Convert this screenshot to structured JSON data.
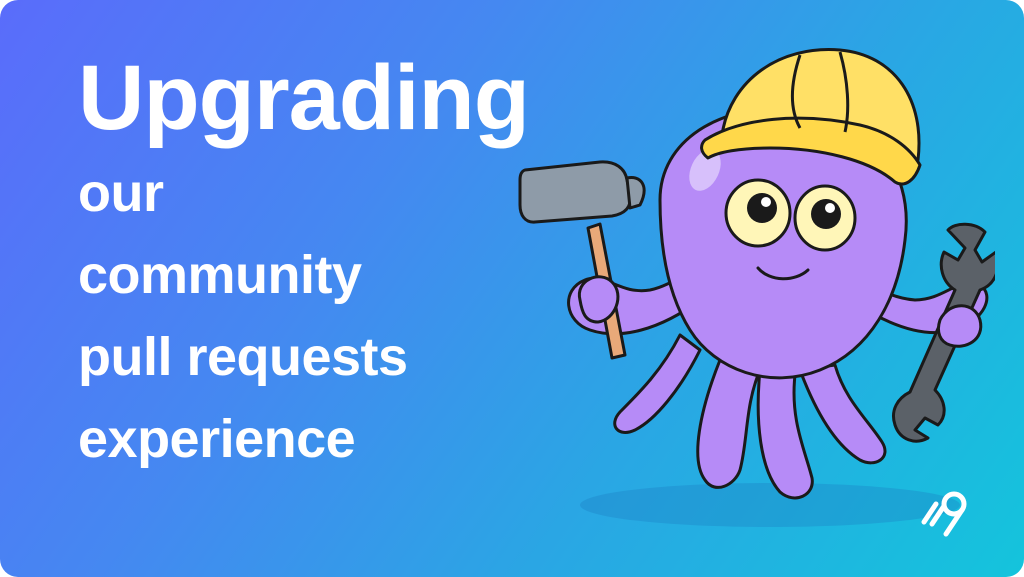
{
  "headline": {
    "line1": "Upgrading",
    "line2": "our",
    "line3": "community",
    "line4": "pull requests",
    "line5": "experience"
  },
  "colors": {
    "gradient_start": "#5a6cfb",
    "gradient_end": "#14c4dc",
    "text": "#ffffff",
    "octopus_body": "#b68bf7",
    "helmet": "#ffe066"
  },
  "icons": {
    "mascot": "octopus-construction-mascot",
    "logo": "brand-logo-icon"
  }
}
